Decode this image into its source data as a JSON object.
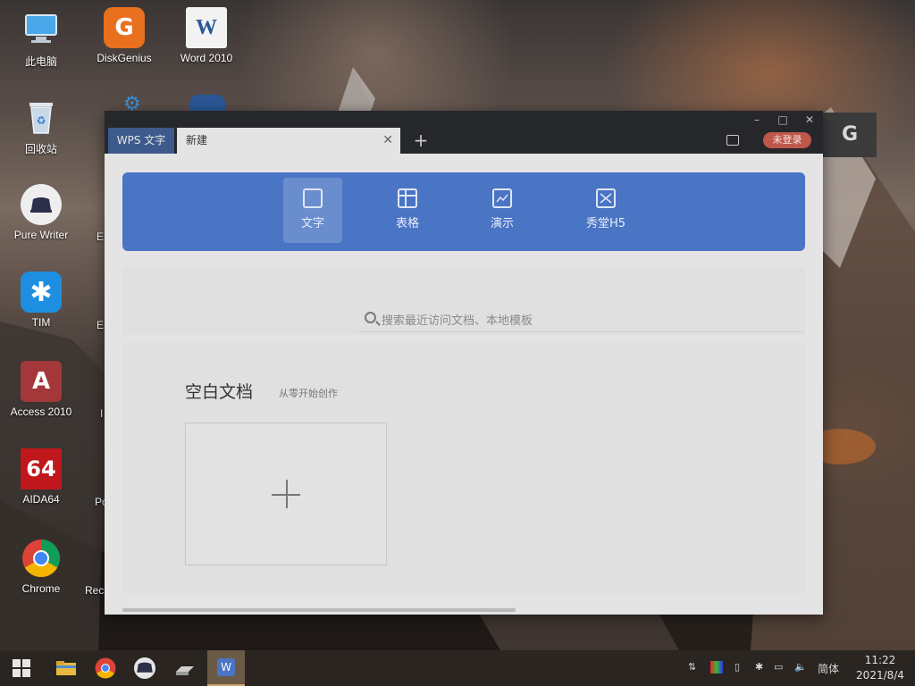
{
  "desktop": {
    "icons": [
      {
        "label": "此电脑",
        "icon": "computer-icon",
        "color": "#3a8fd8"
      },
      {
        "label": "DiskGenius",
        "icon": "diskgenius-icon",
        "color": "#e8701e"
      },
      {
        "label": "Word 2010",
        "icon": "word-icon",
        "color": "#2b5797"
      },
      {
        "label": "回收站",
        "icon": "recycle-bin-icon",
        "color": "#9ab8d8"
      },
      {
        "label": "Pure Writer",
        "icon": "pure-writer-icon",
        "color": "#eeeeee"
      },
      {
        "label": "TIM",
        "icon": "tim-icon",
        "color": "#1e8fe0"
      },
      {
        "label": "Access 2010",
        "icon": "access-icon",
        "color": "#a4373a"
      },
      {
        "label": "AIDA64",
        "icon": "aida64-icon",
        "color": "#c0171c"
      },
      {
        "label": "Chrome",
        "icon": "chrome-icon",
        "color": "#dd4b39"
      }
    ],
    "partial_labels": [
      "E",
      "E",
      "I",
      "Po",
      "Rec"
    ]
  },
  "window": {
    "tabs": [
      {
        "label": "WPS 文字"
      },
      {
        "label": "新建"
      }
    ],
    "add_tab": "+",
    "login_button": "未登录",
    "controls": {
      "minimize": "–",
      "maximize": "□",
      "close": "✕"
    },
    "doc_types": [
      {
        "label": "文字",
        "icon": "document-icon",
        "active": true
      },
      {
        "label": "表格",
        "icon": "spreadsheet-icon",
        "active": false
      },
      {
        "label": "演示",
        "icon": "presentation-icon",
        "active": false
      },
      {
        "label": "秀堂H5",
        "icon": "h5-icon",
        "active": false
      }
    ],
    "search_placeholder": "搜索最近访问文档、本地模板",
    "blank_section": {
      "title": "空白文档",
      "subtitle": "从零开始创作"
    },
    "accent_color": "#4a74c4"
  },
  "side_window_letter": "G",
  "taskbar": {
    "apps": [
      "start-icon",
      "file-explorer-icon",
      "chrome-icon",
      "pure-writer-icon",
      "drive-icon",
      "wps-icon"
    ],
    "tray": {
      "ime": "简体"
    },
    "clock": {
      "time": "11:22",
      "date": "2021/8/4"
    }
  }
}
